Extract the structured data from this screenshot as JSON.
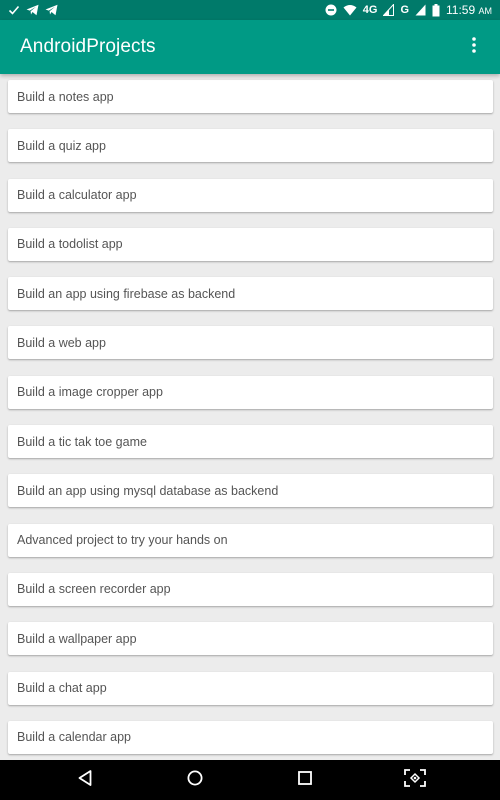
{
  "status_bar": {
    "left_icons": [
      "check-icon",
      "telegram-icon",
      "telegram-icon"
    ],
    "network_label": "4G",
    "network_label_2": "G",
    "time": "11:59",
    "time_suffix": "AM"
  },
  "app_bar": {
    "title": "AndroidProjects",
    "overflow_icon": "more-vert-icon"
  },
  "projects": [
    "Build a notes app",
    "Build a quiz app",
    "Build a calculator app",
    "Build a todolist app",
    "Build an app using firebase as backend",
    "Build a web app",
    "Build a image cropper app",
    "Build a tic tak toe game",
    "Build an app using mysql database as backend",
    "Advanced project to try your hands on",
    "Build a screen recorder app",
    "Build a wallpaper app",
    "Build a chat app",
    "Build a calendar app"
  ],
  "nav_bar": {
    "buttons": [
      "back-icon",
      "home-icon",
      "recents-icon",
      "screenshot-icon"
    ]
  },
  "colors": {
    "status_bar": "#007a6a",
    "app_bar": "#009a85",
    "background": "#ececec",
    "card": "#ffffff",
    "card_text": "#555555"
  }
}
